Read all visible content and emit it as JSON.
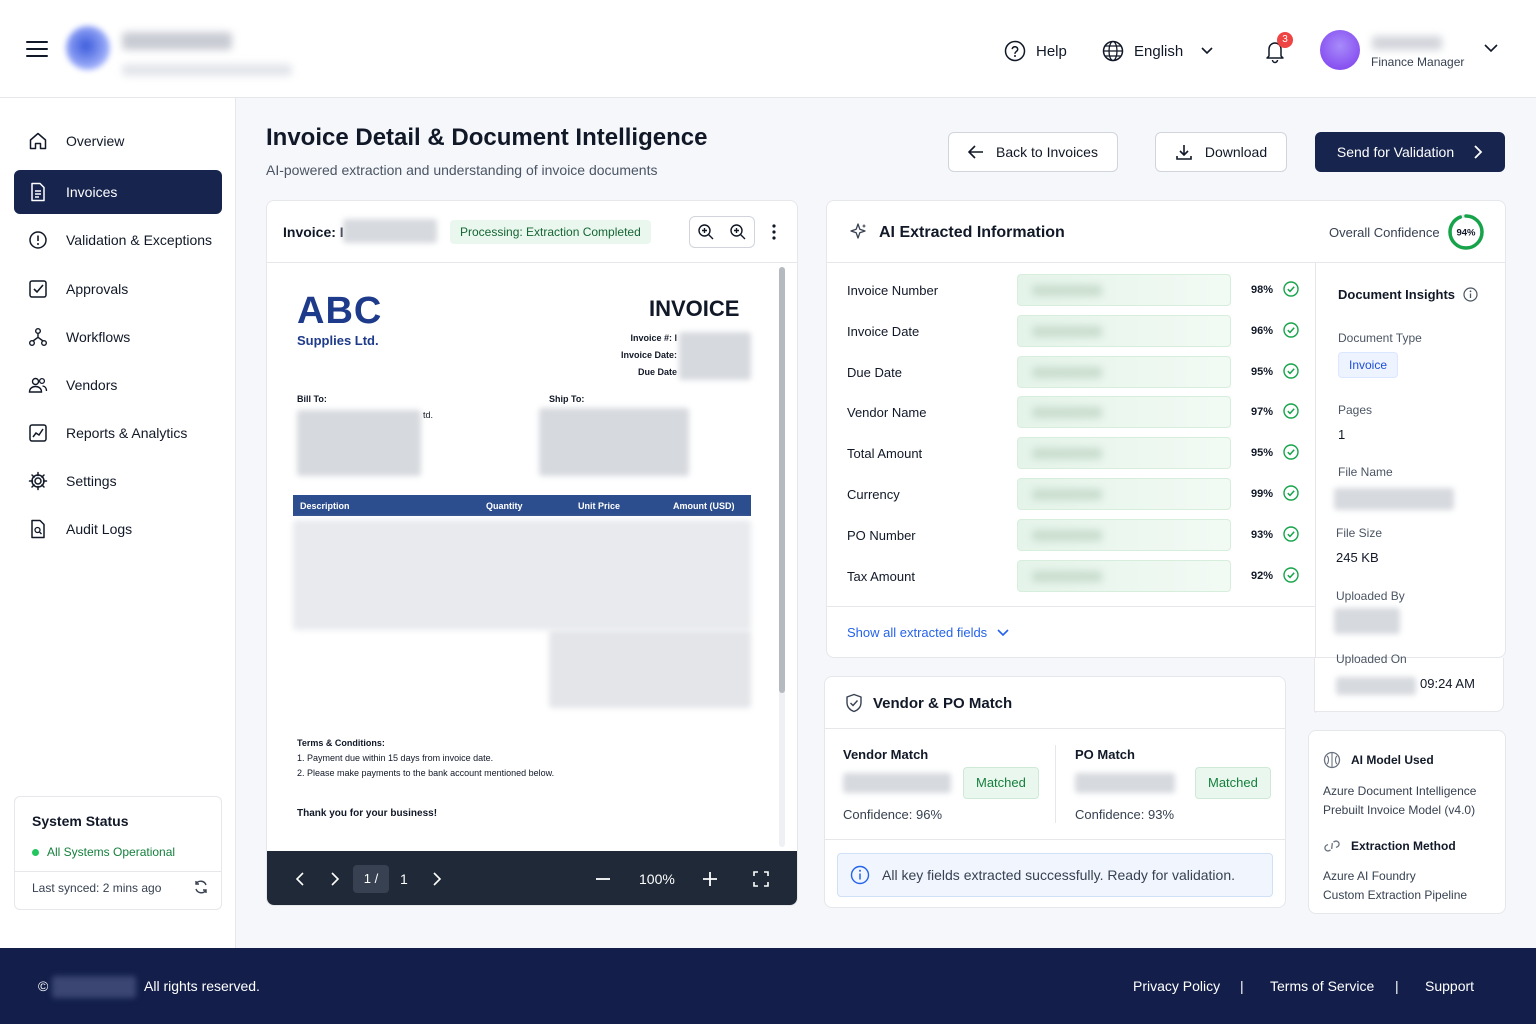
{
  "header": {
    "help": "Help",
    "language": "English",
    "notification_count": "3",
    "user_role": "Finance Manager"
  },
  "sidebar": {
    "items": [
      {
        "label": "Overview",
        "icon": "home-icon"
      },
      {
        "label": "Invoices",
        "icon": "document-icon",
        "active": true
      },
      {
        "label": "Validation & Exceptions",
        "icon": "alert-circle-icon"
      },
      {
        "label": "Approvals",
        "icon": "checkbox-icon"
      },
      {
        "label": "Workflows",
        "icon": "workflow-icon"
      },
      {
        "label": "Vendors",
        "icon": "users-icon"
      },
      {
        "label": "Reports & Analytics",
        "icon": "chart-icon"
      },
      {
        "label": "Settings",
        "icon": "gear-icon"
      },
      {
        "label": "Audit Logs",
        "icon": "audit-icon"
      }
    ],
    "status": {
      "title": "System Status",
      "state": "All Systems Operational",
      "last_synced": "Last synced: 2 mins ago"
    }
  },
  "page": {
    "title": "Invoice Detail & Document Intelligence",
    "subtitle": "AI-powered extraction and understanding of invoice documents",
    "back_button": "Back to Invoices",
    "download_button": "Download",
    "send_button": "Send for Validation"
  },
  "viewer": {
    "invoice_label": "Invoice: I",
    "status_badge": "Processing: Extraction Completed",
    "doc": {
      "company": "ABC",
      "company_sub": "Supplies Ltd.",
      "title": "INVOICE",
      "invoice_no_label": "Invoice #: I",
      "invoice_date_label": "Invoice Date:",
      "due_date_label": "Due Date",
      "bill_to": "Bill To:",
      "ship_to": "Ship To:",
      "bill_to_partial": "td.",
      "table_headers": [
        "Description",
        "Quantity",
        "Unit Price",
        "Amount (USD)"
      ],
      "terms_title": "Terms & Conditions:",
      "terms": [
        "1. Payment due within 15 days from invoice date.",
        "2. Please make payments to the bank account mentioned below."
      ],
      "thanks": "Thank you for your business!"
    },
    "footer": {
      "page_current": "1 /",
      "page_total": "1",
      "zoom": "100%"
    }
  },
  "ai": {
    "title": "AI Extracted Information",
    "overall_label": "Overall Confidence",
    "overall_value": "94%",
    "overall_fraction": 0.94,
    "fields": [
      {
        "label": "Invoice Number",
        "confidence": "98%"
      },
      {
        "label": "Invoice Date",
        "confidence": "96%"
      },
      {
        "label": "Due Date",
        "confidence": "95%"
      },
      {
        "label": "Vendor Name",
        "confidence": "97%"
      },
      {
        "label": "Total Amount",
        "confidence": "95%"
      },
      {
        "label": "Currency",
        "confidence": "99%"
      },
      {
        "label": "PO Number",
        "confidence": "93%"
      },
      {
        "label": "Tax Amount",
        "confidence": "92%"
      }
    ],
    "show_all": "Show all extracted fields",
    "insights": {
      "title": "Document Insights",
      "doc_type_label": "Document Type",
      "doc_type_value": "Invoice",
      "pages_label": "Pages",
      "pages_value": "1",
      "file_name_label": "File Name",
      "file_size_label": "File Size",
      "file_size_value": "245 KB",
      "uploaded_by_label": "Uploaded By",
      "uploaded_on_label": "Uploaded On",
      "uploaded_on_time": "09:24 AM"
    }
  },
  "match": {
    "title": "Vendor & PO Match",
    "vendor_label": "Vendor Match",
    "vendor_status": "Matched",
    "vendor_conf": "Confidence: 96%",
    "po_label": "PO Match",
    "po_status": "Matched",
    "po_conf": "Confidence: 93%",
    "info": "All key fields extracted successfully. Ready for validation."
  },
  "model": {
    "title": "AI Model Used",
    "line1": "Azure Document Intelligence",
    "line2": "Prebuilt Invoice Model (v4.0)",
    "method_title": "Extraction Method",
    "method1": "Azure AI Foundry",
    "method2": "Custom Extraction Pipeline"
  },
  "footer": {
    "copyright_symbol": "©",
    "rights": "All rights reserved.",
    "links": [
      "Privacy Policy",
      "Terms of Service",
      "Support"
    ],
    "separator": "|"
  },
  "colors": {
    "primary": "#16244e",
    "success": "#16a34a",
    "link": "#2563eb",
    "badge_red": "#ef4444"
  }
}
